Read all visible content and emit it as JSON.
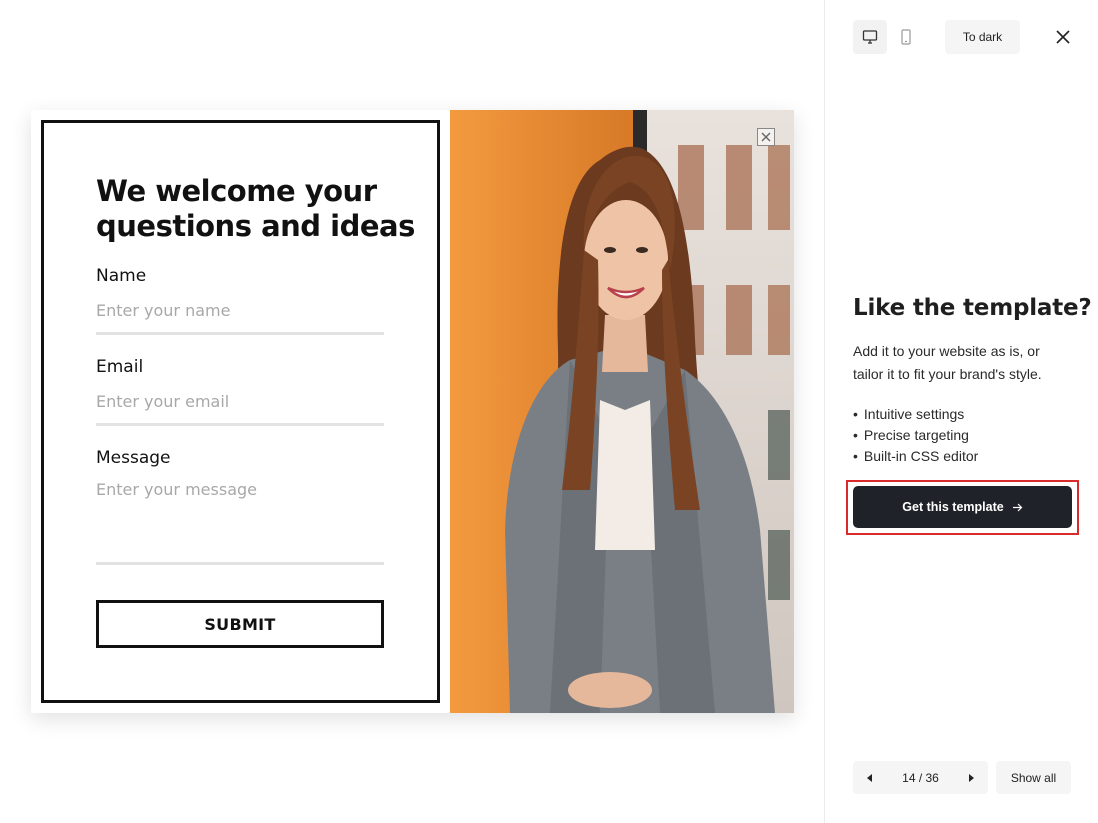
{
  "popup": {
    "title": "We welcome your questions and ideas",
    "fields": [
      {
        "label": "Name",
        "placeholder": "Enter your name"
      },
      {
        "label": "Email",
        "placeholder": "Enter your email"
      },
      {
        "label": "Message",
        "placeholder": "Enter your message"
      }
    ],
    "submit_label": "SUBMIT",
    "close_icon": "close-icon",
    "photo_icon": "portrait-photo"
  },
  "toolbar": {
    "desktop_icon": "desktop-icon",
    "mobile_icon": "mobile-icon",
    "dark_label": "To dark",
    "close_icon": "close-icon"
  },
  "sidebar": {
    "title": "Like the template?",
    "description": "Add it to your website as is, or tailor it to fit your brand's style.",
    "features": [
      "Intuitive settings",
      "Precise targeting",
      "Built-in CSS editor"
    ],
    "cta_label": "Get this template",
    "cta_icon": "arrow-right-icon",
    "highlight_color": "#d92b2b"
  },
  "pager": {
    "count": "14 / 36",
    "prev_icon": "triangle-left-icon",
    "next_icon": "triangle-right-icon",
    "show_all_label": "Show all"
  },
  "colors": {
    "cta_bg": "#1f2329",
    "photo_orange": "#f2953b",
    "border_dark": "#111111"
  }
}
